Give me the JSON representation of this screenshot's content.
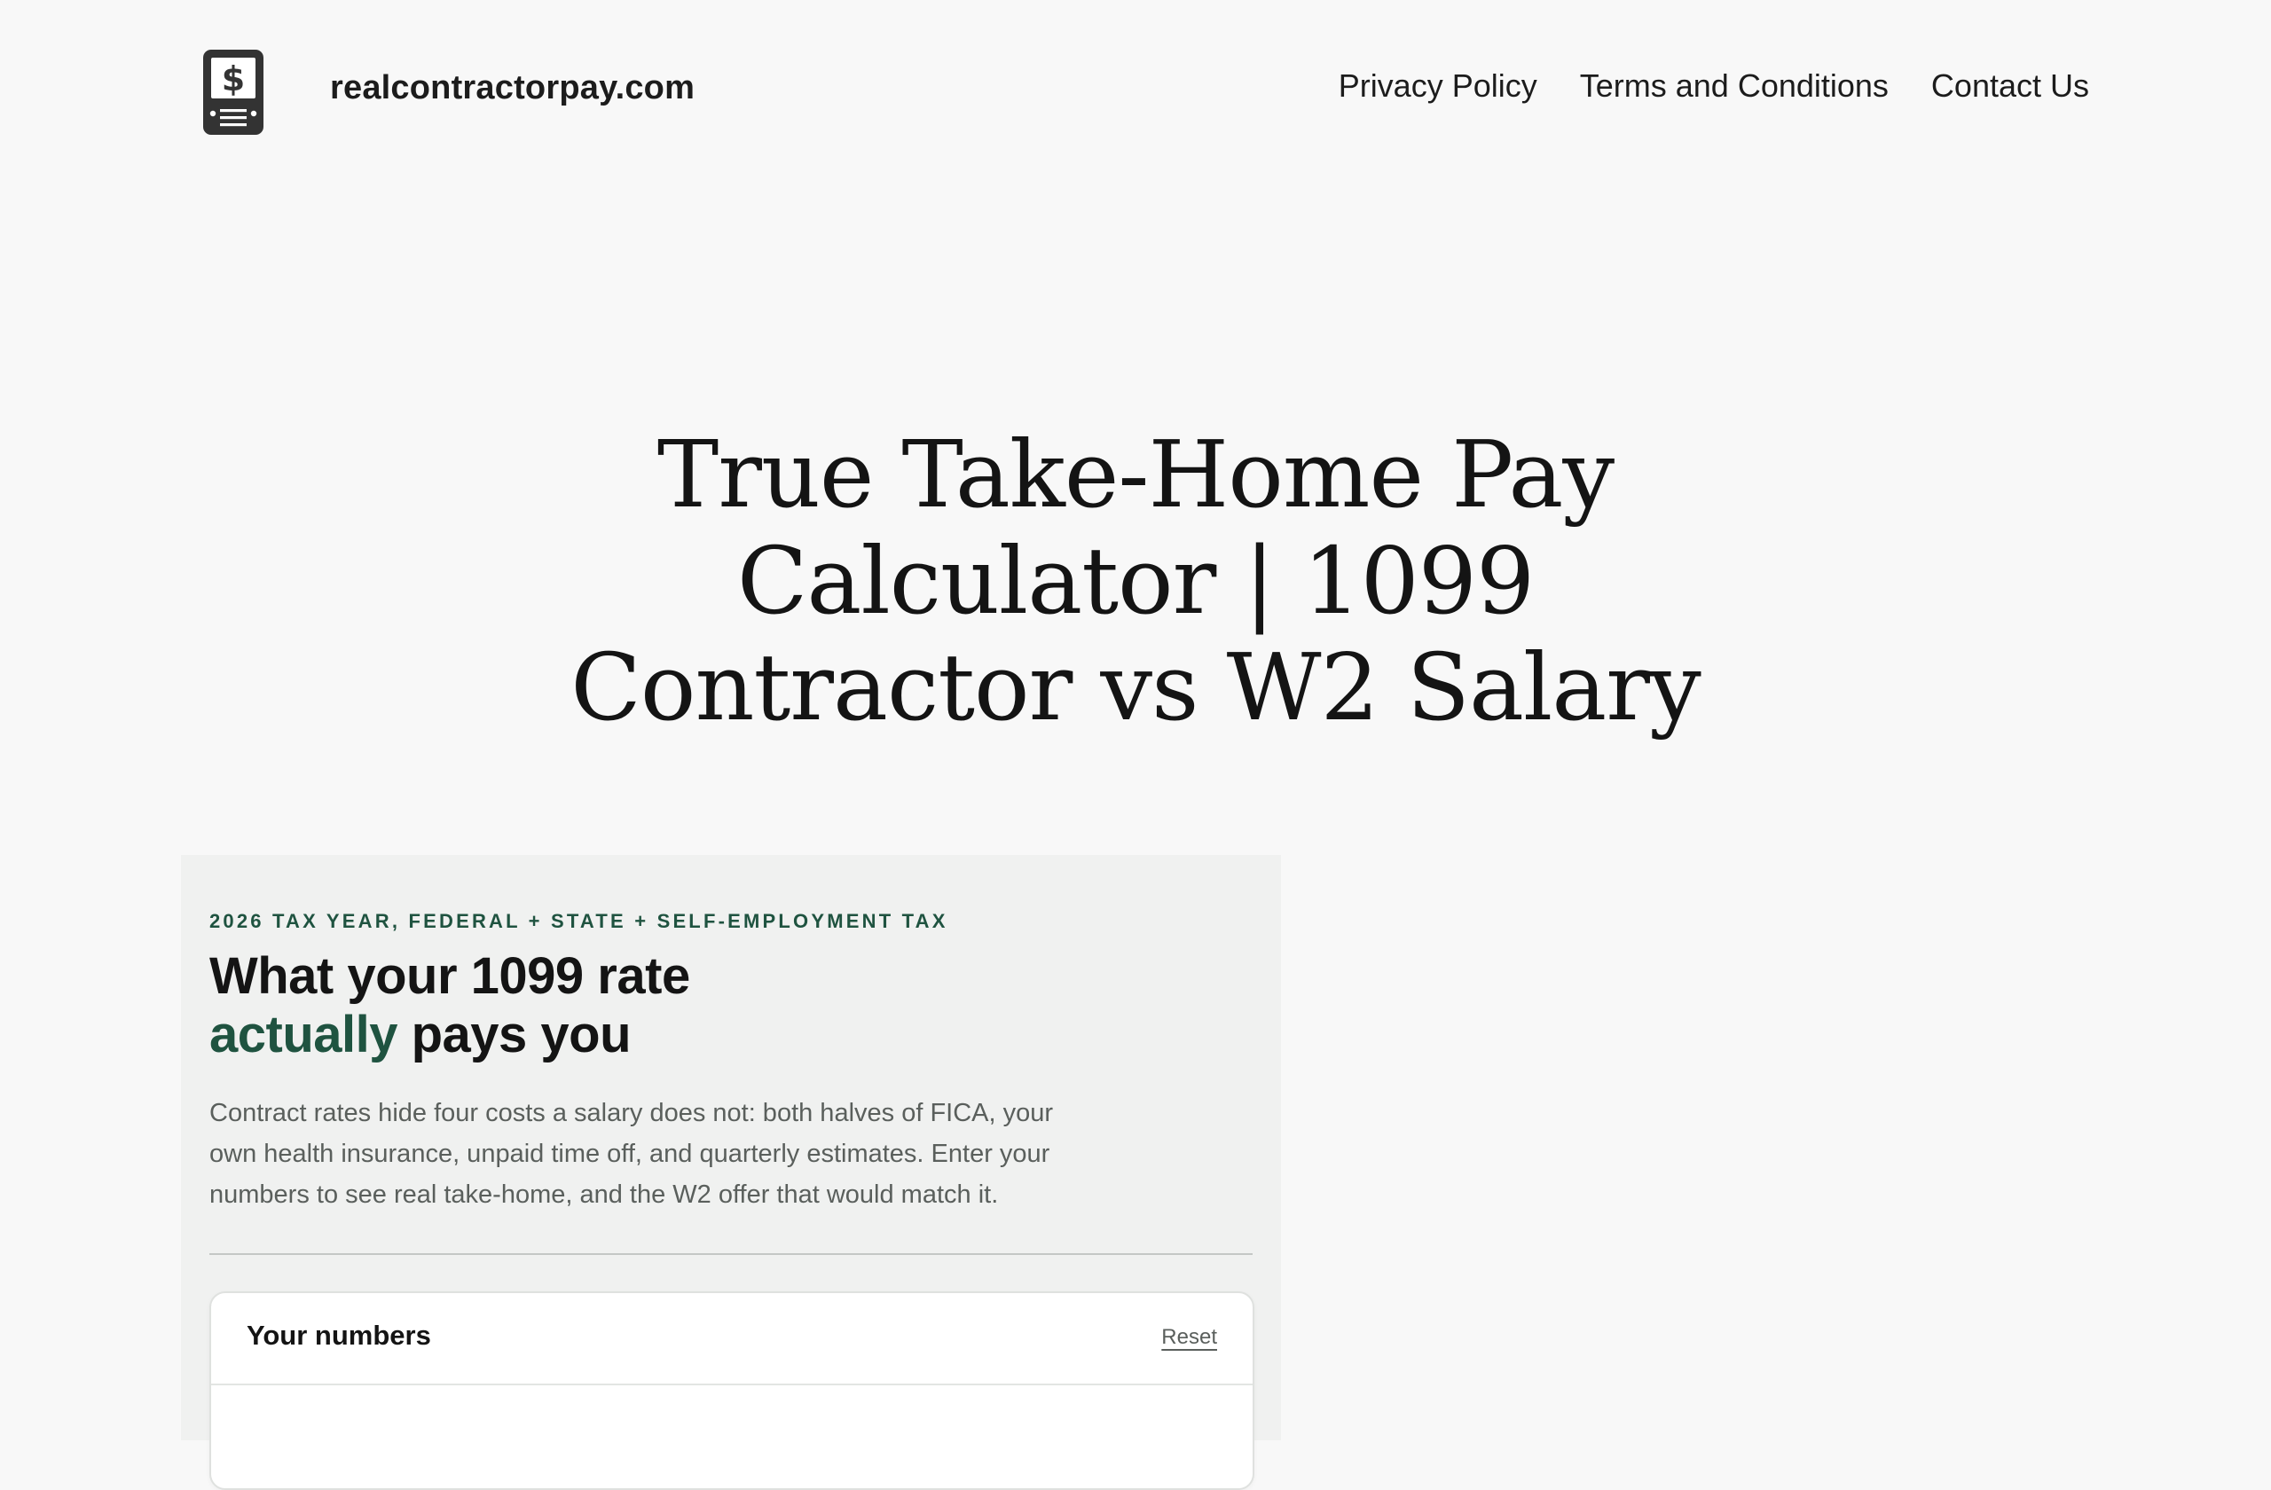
{
  "header": {
    "site_title": "realcontractorpay.com",
    "logo_icon": "calculator-dollar-icon",
    "nav": [
      {
        "label": "Privacy Policy"
      },
      {
        "label": "Terms and Conditions"
      },
      {
        "label": "Contact Us"
      }
    ]
  },
  "hero": {
    "title_lines": [
      "True Take-Home Pay",
      "Calculator | 1099",
      "Contractor vs W2 Salary"
    ]
  },
  "calculator": {
    "eyebrow": "2026 TAX YEAR, FEDERAL + STATE + SELF-EMPLOYMENT TAX",
    "heading_line1": "What your 1099 rate",
    "heading_accent": "actually",
    "heading_line2_rest": " pays you",
    "description": "Contract rates hide four costs a salary does not: both halves of FICA, your own health insurance, unpaid time off, and quarterly estimates. Enter your numbers to see real take-home, and the W2 offer that would match it.",
    "numbers_card": {
      "title": "Your numbers",
      "reset_label": "Reset"
    }
  },
  "colors": {
    "accent_green": "#1f5340",
    "page_bg": "#f8f8f8",
    "panel_bg": "#f0f1f0",
    "logo_dark": "#333333"
  }
}
